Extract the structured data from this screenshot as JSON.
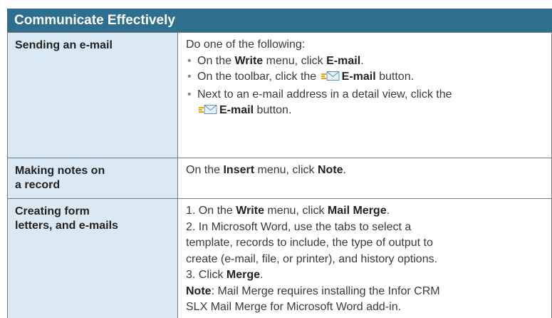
{
  "title": "Communicate Effectively",
  "rows": [
    {
      "label": "Sending an e-mail",
      "intro": "Do one of the following:",
      "bullets": [
        {
          "prefix": "On the ",
          "bold1": "Write",
          "mid": " menu, click ",
          "bold2": "E-mail",
          "suffix": "."
        },
        {
          "prefix": "On the toolbar, click the ",
          "icon": "email-icon",
          "bold": "E-mail",
          "suffix": " button."
        },
        {
          "line1": "Next to an e-mail address in a detail view, click the",
          "icon": "email-icon",
          "bold": "E-mail",
          "suffix": " button."
        }
      ]
    },
    {
      "label_line1": "Making notes on",
      "label_line2": "a record",
      "prefix": "On the ",
      "bold1": "Insert",
      "mid": " menu, click ",
      "bold2": "Note",
      "suffix": "."
    },
    {
      "label_line1": "Creating form",
      "label_line2": "letters, and e-mails",
      "step1": {
        "prefix": "1.  On the ",
        "bold1": "Write",
        "mid": " menu, click ",
        "bold2": "Mail Merge",
        "suffix": "."
      },
      "step2_lines": [
        "2.  In Microsoft Word, use the tabs to select a",
        "template, records to include, the type of output to",
        "create (e-mail, file, or printer), and history options."
      ],
      "step3": {
        "prefix": "3.  Click ",
        "bold": "Merge",
        "suffix": "."
      },
      "note": {
        "bold": "Note",
        "line1": ": Mail Merge requires installing the Infor CRM",
        "line2": "SLX Mail Merge for Microsoft Word add-in."
      }
    }
  ]
}
